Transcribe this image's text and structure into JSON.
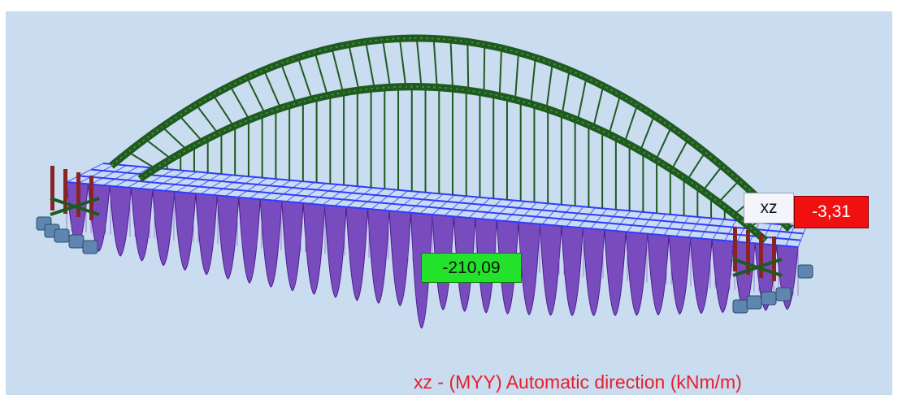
{
  "viewport": {
    "plane_label": "xz",
    "min_label": "-3,31",
    "max_label": "-210,09",
    "caption": "xz - (MYY) Automatic direction (kNm/m)"
  },
  "colors": {
    "background": "#c9dcf0",
    "arch_structure": "#1f5a1f",
    "deck_grid": "#2f3cff",
    "moment_diagram": "#6a32b4",
    "supports": "#5f86b0",
    "max_value_bg": "#22e32a",
    "min_value_bg": "#f01010",
    "caption_text": "#ea1e2b"
  },
  "icons": {
    "supports": "support-block-icon"
  }
}
